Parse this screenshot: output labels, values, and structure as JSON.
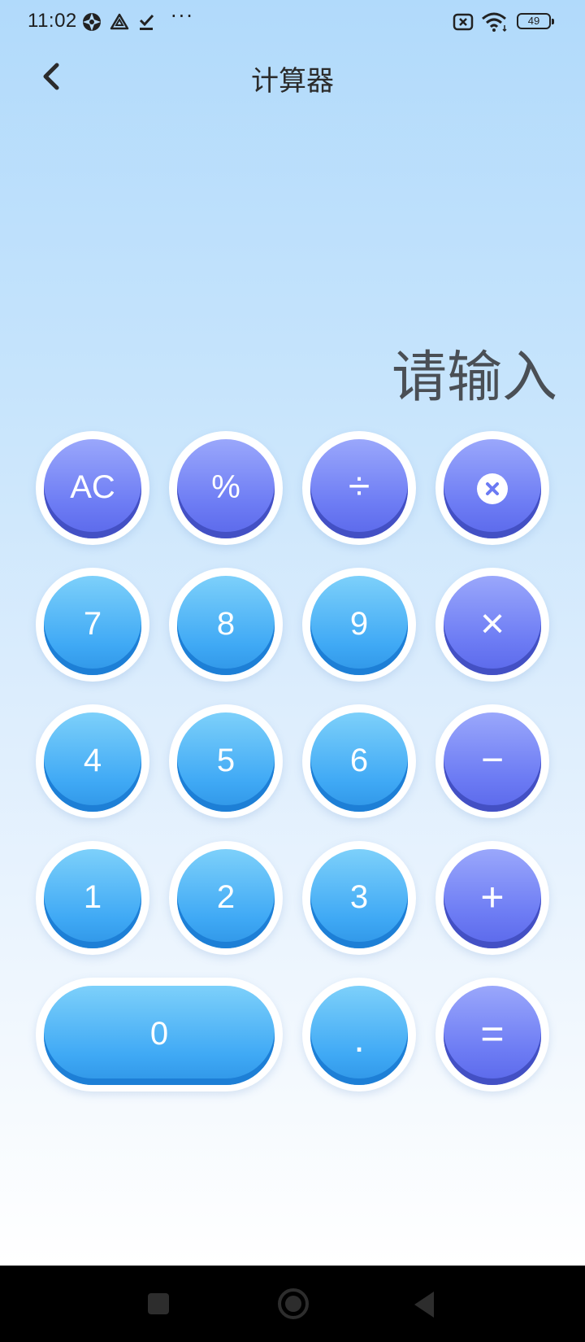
{
  "status_bar": {
    "time": "11:02",
    "battery_level": "49"
  },
  "header": {
    "title": "计算器"
  },
  "display": {
    "placeholder": "请输入"
  },
  "keypad": {
    "colors": {
      "number_key": "#3fa9f5",
      "operator_key": "#6d7cf4"
    },
    "keys": {
      "ac": "AC",
      "percent": "%",
      "divide": "÷",
      "backspace_icon": "delete-circle-icon",
      "seven": "7",
      "eight": "8",
      "nine": "9",
      "multiply": "×",
      "four": "4",
      "five": "5",
      "six": "6",
      "minus": "−",
      "one": "1",
      "two": "2",
      "three": "3",
      "plus": "+",
      "zero": "0",
      "dot": ".",
      "equals": "="
    }
  }
}
